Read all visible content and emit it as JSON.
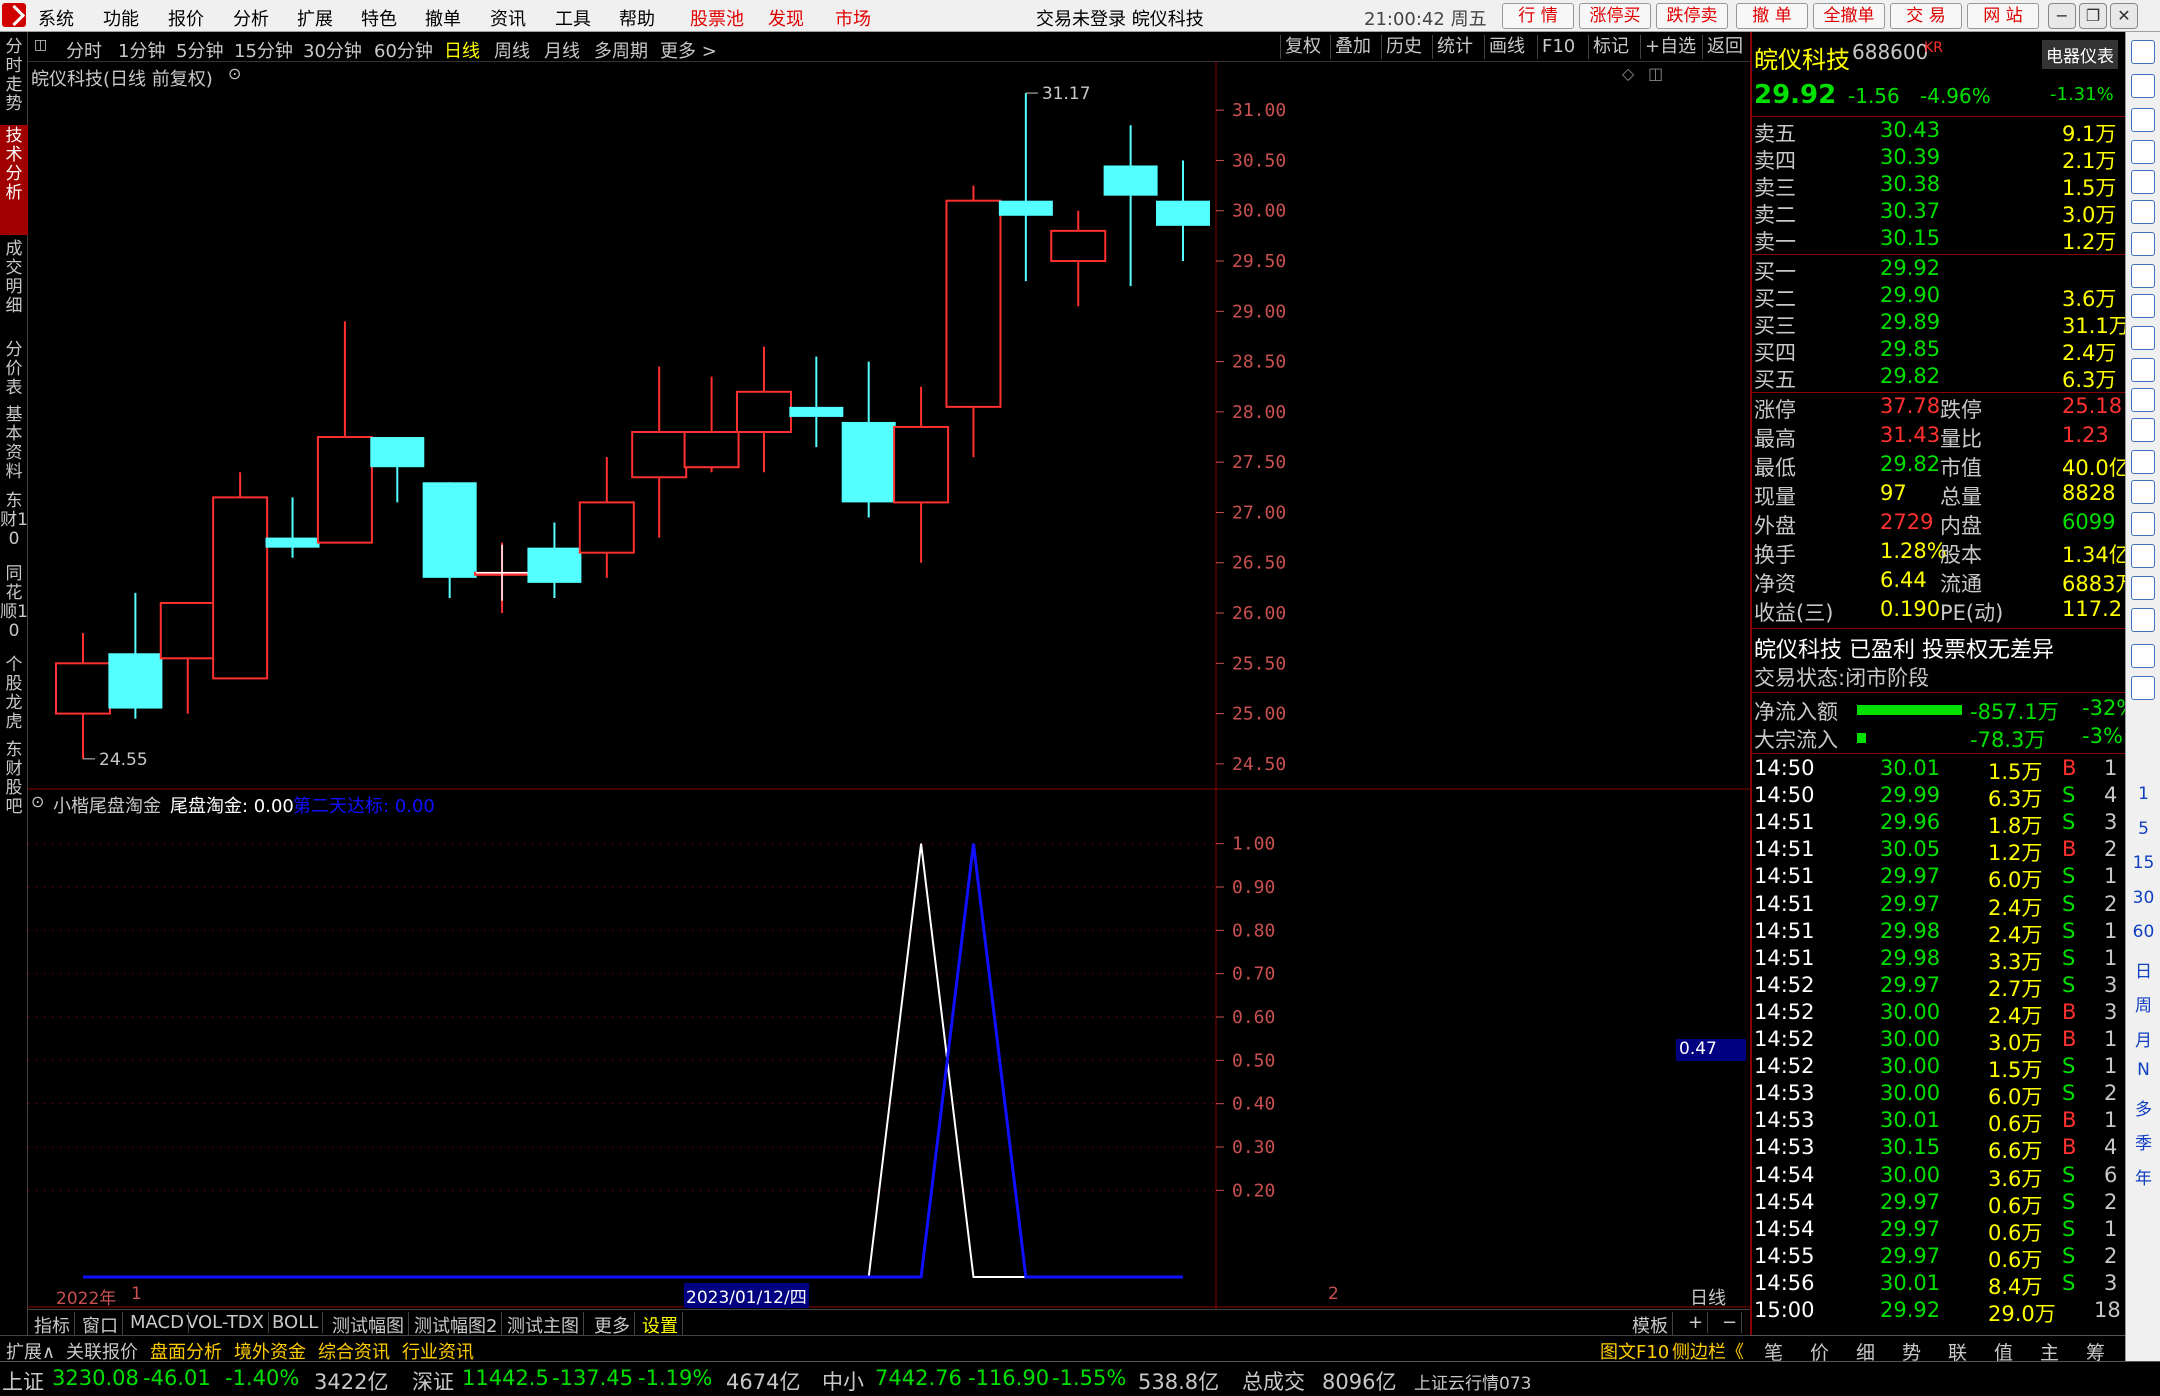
{
  "menu": {
    "items": [
      "系统",
      "功能",
      "报价",
      "分析",
      "扩展",
      "特色",
      "撤单",
      "资讯",
      "工具",
      "帮助"
    ],
    "red_items": [
      "股票池",
      "发现",
      "市场"
    ],
    "title": "交易未登录 皖仪科技",
    "clock": "21:00:42 周五",
    "buttons": [
      "行 情",
      "涨停买",
      "跌停卖",
      "撤 单",
      "全撤单",
      "交 易",
      "网 站"
    ]
  },
  "left_tabs": [
    "分时走势",
    "技术分析",
    "成交明细",
    "分价表",
    "基本资料",
    "东财10",
    "同花顺10",
    "个股龙虎",
    "东财股吧"
  ],
  "toolbar": {
    "periods": [
      "分时",
      "1分钟",
      "5分钟",
      "15分钟",
      "30分钟",
      "60分钟",
      "日线",
      "周线",
      "月线",
      "多周期",
      "更多 >"
    ],
    "selected": "日线",
    "right": [
      "复权",
      "叠加",
      "历史",
      "统计",
      "画线",
      "F10",
      "标记",
      "+自选",
      "返回"
    ]
  },
  "chart_title": "皖仪科技(日线 前复权)",
  "indicator": {
    "name": "小楷尾盘淘金",
    "value_label": "尾盘淘金: 0.00",
    "value2_label": "第二天达标: 0.00",
    "cursor_value": "0.47"
  },
  "chart_data": [
    {
      "type": "candlestick",
      "title": "皖仪科技(日线 前复权)",
      "ylim": [
        24.3,
        31.3
      ],
      "yticks": [
        24.5,
        25.0,
        25.5,
        26.0,
        26.5,
        27.0,
        27.5,
        28.0,
        28.5,
        29.0,
        29.5,
        30.0,
        30.5,
        31.0
      ],
      "ohlc": [
        {
          "o": 25.0,
          "h": 25.8,
          "l": 24.55,
          "c": 25.5
        },
        {
          "o": 25.6,
          "h": 26.2,
          "l": 24.95,
          "c": 25.05
        },
        {
          "o": 25.55,
          "h": 26.05,
          "l": 25.0,
          "c": 26.1
        },
        {
          "o": 25.35,
          "h": 27.4,
          "l": 25.35,
          "c": 27.15
        },
        {
          "o": 26.75,
          "h": 27.15,
          "l": 26.55,
          "c": 26.65
        },
        {
          "o": 26.7,
          "h": 28.9,
          "l": 26.7,
          "c": 27.75
        },
        {
          "o": 27.75,
          "h": 27.75,
          "l": 27.1,
          "c": 27.45
        },
        {
          "o": 27.3,
          "h": 27.3,
          "l": 26.15,
          "c": 26.35
        },
        {
          "o": 26.4,
          "h": 26.7,
          "l": 26.0,
          "c": 26.4
        },
        {
          "o": 26.65,
          "h": 26.9,
          "l": 26.15,
          "c": 26.3
        },
        {
          "o": 26.6,
          "h": 27.55,
          "l": 26.35,
          "c": 27.1
        },
        {
          "o": 27.35,
          "h": 28.45,
          "l": 26.75,
          "c": 27.8
        },
        {
          "o": 27.45,
          "h": 28.35,
          "l": 27.4,
          "c": 27.8
        },
        {
          "o": 27.8,
          "h": 28.65,
          "l": 27.4,
          "c": 28.2
        },
        {
          "o": 28.05,
          "h": 28.55,
          "l": 27.65,
          "c": 27.95
        },
        {
          "o": 27.9,
          "h": 28.5,
          "l": 26.95,
          "c": 27.1
        },
        {
          "o": 27.1,
          "h": 28.25,
          "l": 26.5,
          "c": 27.85
        },
        {
          "o": 28.05,
          "h": 30.25,
          "l": 27.55,
          "c": 30.1
        },
        {
          "o": 30.1,
          "h": 31.17,
          "l": 29.3,
          "c": 29.95
        },
        {
          "o": 29.5,
          "h": 30.0,
          "l": 29.05,
          "c": 29.8
        },
        {
          "o": 30.45,
          "h": 30.85,
          "l": 29.25,
          "c": 30.15
        },
        {
          "o": 30.1,
          "h": 30.5,
          "l": 29.5,
          "c": 29.85
        }
      ],
      "annotations": {
        "high": "31.17",
        "low": "24.55"
      }
    },
    {
      "type": "line",
      "title": "小楷尾盘淘金",
      "ylim": [
        0,
        1.05
      ],
      "yticks": [
        "1.00",
        "0.90",
        "0.80",
        "0.70",
        "0.60",
        "0.50",
        "0.40",
        "0.30",
        "0.20"
      ],
      "series": [
        {
          "name": "尾盘淘金",
          "color": "#ffffff",
          "values": [
            0,
            0,
            0,
            0,
            0,
            0,
            0,
            0,
            0,
            0,
            0,
            0,
            0,
            0,
            0,
            0,
            1,
            0,
            0,
            0,
            0,
            0
          ]
        },
        {
          "name": "第二天达标",
          "color": "#1010ff",
          "values": [
            0,
            0,
            0,
            0,
            0,
            0,
            0,
            0,
            0,
            0,
            0,
            0,
            0,
            0,
            0,
            0,
            0,
            1,
            0,
            0,
            0,
            0
          ]
        }
      ]
    }
  ],
  "x_axis": {
    "year": "2022年",
    "m1": "1",
    "date": "2023/01/12/四",
    "m2": "2",
    "period": "日线"
  },
  "bottom_tabs": [
    "指标",
    "窗口",
    "MACD",
    "VOL-TDX",
    "BOLL",
    "测试幅图",
    "测试幅图2",
    "测试主图",
    "更多",
    "设置",
    "模板",
    "+",
    "−"
  ],
  "footer_tabs": [
    "扩展∧",
    "关联报价",
    "盘面分析",
    "境外资金",
    "综合资讯",
    "行业资讯"
  ],
  "footer_right": [
    "图文F10",
    "侧边栏《"
  ],
  "status": {
    "sh_label": "上证",
    "sh_val": "3230.08",
    "sh_chg": "-46.01",
    "sh_pct": "-1.40%",
    "sh_amt": "3422亿",
    "sz_label": "深证",
    "sz_val": "11442.5",
    "sz_chg": "-137.45",
    "sz_pct": "-1.19%",
    "sz_amt": "4674亿",
    "zx_label": "中小",
    "zx_val": "7442.76",
    "zx_chg": "-116.90",
    "zx_pct": "-1.55%",
    "zx_amt": "538.8亿",
    "total_label": "总成交",
    "total_val": "8096亿",
    "cloud": "上证云行情073"
  },
  "quote": {
    "name": "皖仪科技",
    "code": "688600",
    "tag": "KR",
    "sector": "电器仪表",
    "sector_pct": "-1.31%",
    "price": "29.92",
    "change": "-1.56",
    "pct": "-4.96%",
    "asks": [
      [
        "卖五",
        "30.43",
        "9.1万"
      ],
      [
        "卖四",
        "30.39",
        "2.1万"
      ],
      [
        "卖三",
        "30.38",
        "1.5万"
      ],
      [
        "卖二",
        "30.37",
        "3.0万"
      ],
      [
        "卖一",
        "30.15",
        "1.2万"
      ]
    ],
    "bids": [
      [
        "买一",
        "29.92",
        ""
      ],
      [
        "买二",
        "29.90",
        "3.6万"
      ],
      [
        "买三",
        "29.89",
        "31.1万"
      ],
      [
        "买四",
        "29.85",
        "2.4万"
      ],
      [
        "买五",
        "29.82",
        "6.3万"
      ]
    ],
    "stats": [
      [
        "涨停",
        "37.78",
        "跌停",
        "25.18"
      ],
      [
        "最高",
        "31.43",
        "量比",
        "1.23"
      ],
      [
        "最低",
        "29.82",
        "市值",
        "40.0亿"
      ],
      [
        "现量",
        "97",
        "总量",
        "8828"
      ],
      [
        "外盘",
        "2729",
        "内盘",
        "6099"
      ],
      [
        "换手",
        "1.28%",
        "股本",
        "1.34亿"
      ],
      [
        "净资",
        "6.44",
        "流通",
        "6883万"
      ],
      [
        "收益(三)",
        "0.190",
        "PE(动)",
        "117.2"
      ]
    ],
    "note": "皖仪科技 已盈利 投票权无差异",
    "trade_status": "交易状态:闭市阶段",
    "flow": [
      [
        "净流入额",
        "-857.1万",
        "-32%",
        0.7
      ],
      [
        "大宗流入",
        "-78.3万",
        "-3%",
        0.06
      ]
    ],
    "ticks": [
      [
        "14:50",
        "30.01",
        "1.5万",
        "B",
        "1"
      ],
      [
        "14:50",
        "29.99",
        "6.3万",
        "S",
        "4"
      ],
      [
        "14:51",
        "29.96",
        "1.8万",
        "S",
        "3"
      ],
      [
        "14:51",
        "30.05",
        "1.2万",
        "B",
        "2"
      ],
      [
        "14:51",
        "29.97",
        "6.0万",
        "S",
        "1"
      ],
      [
        "14:51",
        "29.97",
        "2.4万",
        "S",
        "2"
      ],
      [
        "14:51",
        "29.98",
        "2.4万",
        "S",
        "1"
      ],
      [
        "14:51",
        "29.98",
        "3.3万",
        "S",
        "1"
      ],
      [
        "14:52",
        "29.97",
        "2.7万",
        "S",
        "3"
      ],
      [
        "14:52",
        "30.00",
        "2.4万",
        "B",
        "3"
      ],
      [
        "14:52",
        "30.00",
        "3.0万",
        "B",
        "1"
      ],
      [
        "14:52",
        "30.00",
        "1.5万",
        "S",
        "1"
      ],
      [
        "14:53",
        "30.00",
        "6.0万",
        "S",
        "2"
      ],
      [
        "14:53",
        "30.01",
        "0.6万",
        "B",
        "1"
      ],
      [
        "14:53",
        "30.15",
        "6.6万",
        "B",
        "4"
      ],
      [
        "14:54",
        "30.00",
        "3.6万",
        "S",
        "6"
      ],
      [
        "14:54",
        "29.97",
        "0.6万",
        "S",
        "2"
      ],
      [
        "14:54",
        "29.97",
        "0.6万",
        "S",
        "1"
      ],
      [
        "14:55",
        "29.97",
        "0.6万",
        "S",
        "2"
      ],
      [
        "14:56",
        "30.01",
        "8.4万",
        "S",
        "3"
      ],
      [
        "15:00",
        "29.92",
        "29.0万",
        "",
        "18"
      ]
    ],
    "bottom_tabs": [
      "笔",
      "价",
      "细",
      "势",
      "联",
      "值",
      "主",
      "筹"
    ]
  },
  "right_icons_text": [
    "1",
    "5",
    "15",
    "30",
    "60",
    "日",
    "周",
    "月",
    "N",
    "多",
    "季",
    "年"
  ],
  "colors": {
    "up": "#ff3030",
    "down": "#54ffff",
    "axis": "#c85050",
    "grid": "#8b0000"
  }
}
